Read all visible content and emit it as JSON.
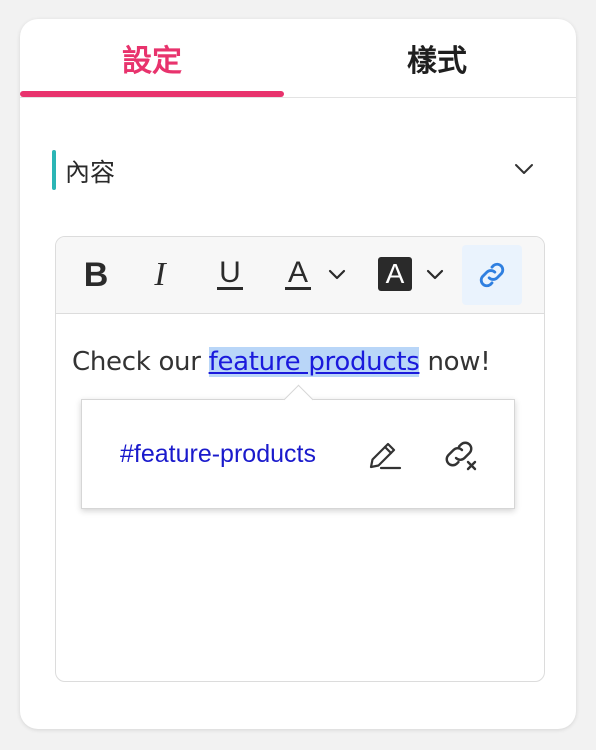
{
  "tabs": [
    {
      "label": "設定",
      "active": true
    },
    {
      "label": "樣式",
      "active": false
    }
  ],
  "section": {
    "title": "內容",
    "accent_color": "#2bb5b5"
  },
  "toolbar": {
    "bold_glyph": "B",
    "italic_glyph": "I",
    "underline_glyph": "U",
    "text_color_glyph": "A",
    "bg_color_glyph": "A",
    "icons": [
      "bold-icon",
      "italic-icon",
      "underline-icon",
      "text-color-icon",
      "chevron-down-icon",
      "background-color-icon",
      "chevron-down-icon",
      "link-icon"
    ]
  },
  "editor": {
    "text_before": "Check our ",
    "link_text": "feature products",
    "text_after": " now!"
  },
  "link_popover": {
    "url": "#feature-products",
    "icons": [
      "edit-pencil-icon",
      "unlink-icon"
    ]
  },
  "colors": {
    "accent": "#e8336d",
    "link": "#1a1adc",
    "link_highlight": "#b9d6f8",
    "active_button_bg": "#eaf3fd",
    "active_icon": "#2f7fe0"
  }
}
